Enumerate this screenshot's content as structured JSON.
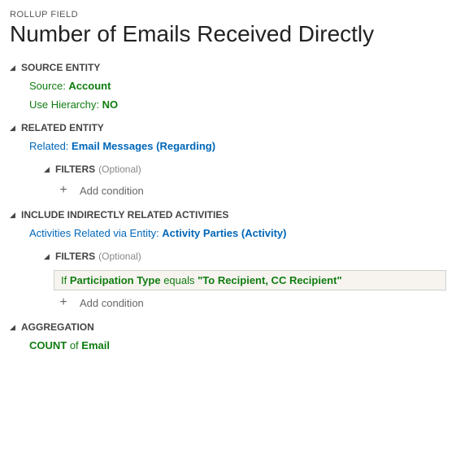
{
  "header": {
    "caption": "ROLLUP FIELD",
    "title": "Number of Emails Received Directly"
  },
  "sections": {
    "source": {
      "label": "Source Entity",
      "source_label": "Source: ",
      "source_value": "Account",
      "hierarchy_label": "Use Hierarchy: ",
      "hierarchy_value": "NO"
    },
    "related": {
      "label": "Related Entity",
      "related_label": "Related: ",
      "related_entity": "Email Messages",
      "related_open": " (",
      "related_field": "Regarding",
      "related_close": ")",
      "filters": {
        "label": "Filters",
        "optional": "(Optional)",
        "add_label": "Add condition"
      }
    },
    "indirect": {
      "label": "Include Indirectly Related Activities",
      "via_label": "Activities Related via Entity: ",
      "via_entity": "Activity Parties",
      "via_open": " (",
      "via_field": "Activity",
      "via_close": ")",
      "filters": {
        "label": "Filters",
        "optional": "(Optional)",
        "condition": {
          "if": "If ",
          "field": "Participation Type",
          "op": " equals ",
          "value": "\"To Recipient, CC Recipient\""
        },
        "add_label": "Add condition"
      }
    },
    "aggregation": {
      "label": "Aggregation",
      "func": "COUNT",
      "of": " of ",
      "field": "Email"
    }
  }
}
